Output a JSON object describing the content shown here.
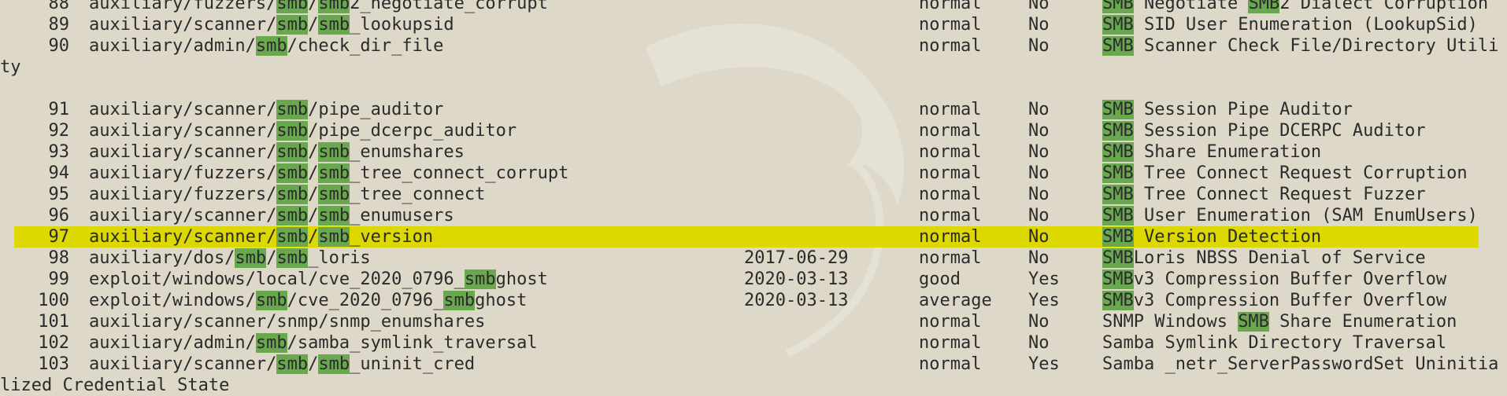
{
  "colors": {
    "background": "#ddd8c8",
    "text": "#2b2b2b",
    "match_highlight": "#6aa84f",
    "selected_row": "#dcd800"
  },
  "rows": [
    {
      "num": "88",
      "name": [
        [
          "auxiliary/fuzzers/",
          false
        ],
        [
          "smb",
          true
        ],
        [
          "/",
          false
        ],
        [
          "smb",
          true
        ],
        [
          "2_negotiate_corrupt",
          false
        ]
      ],
      "date": "",
      "rank": "normal",
      "check": "No",
      "desc": [
        [
          "SMB",
          true
        ],
        [
          " Negotiate ",
          false
        ],
        [
          "SMB",
          true
        ],
        [
          "2 Dialect Corruption",
          false
        ]
      ]
    },
    {
      "num": "89",
      "name": [
        [
          "auxiliary/scanner/",
          false
        ],
        [
          "smb",
          true
        ],
        [
          "/",
          false
        ],
        [
          "smb",
          true
        ],
        [
          "_lookupsid",
          false
        ]
      ],
      "date": "",
      "rank": "normal",
      "check": "No",
      "desc": [
        [
          "SMB",
          true
        ],
        [
          " SID User Enumeration (LookupSid)",
          false
        ]
      ]
    },
    {
      "num": "90",
      "name": [
        [
          "auxiliary/admin/",
          false
        ],
        [
          "smb",
          true
        ],
        [
          "/check_dir_file",
          false
        ]
      ],
      "date": "",
      "rank": "normal",
      "check": "No",
      "desc": [
        [
          "SMB",
          true
        ],
        [
          " Scanner Check File/Directory Utili",
          false
        ]
      ]
    },
    {
      "wrap": "ty"
    },
    {
      "blank": true
    },
    {
      "num": "91",
      "name": [
        [
          "auxiliary/scanner/",
          false
        ],
        [
          "smb",
          true
        ],
        [
          "/pipe_auditor",
          false
        ]
      ],
      "date": "",
      "rank": "normal",
      "check": "No",
      "desc": [
        [
          "SMB",
          true
        ],
        [
          " Session Pipe Auditor",
          false
        ]
      ]
    },
    {
      "num": "92",
      "name": [
        [
          "auxiliary/scanner/",
          false
        ],
        [
          "smb",
          true
        ],
        [
          "/pipe_dcerpc_auditor",
          false
        ]
      ],
      "date": "",
      "rank": "normal",
      "check": "No",
      "desc": [
        [
          "SMB",
          true
        ],
        [
          " Session Pipe DCERPC Auditor",
          false
        ]
      ]
    },
    {
      "num": "93",
      "name": [
        [
          "auxiliary/scanner/",
          false
        ],
        [
          "smb",
          true
        ],
        [
          "/",
          false
        ],
        [
          "smb",
          true
        ],
        [
          "_enumshares",
          false
        ]
      ],
      "date": "",
      "rank": "normal",
      "check": "No",
      "desc": [
        [
          "SMB",
          true
        ],
        [
          " Share Enumeration",
          false
        ]
      ]
    },
    {
      "num": "94",
      "name": [
        [
          "auxiliary/fuzzers/",
          false
        ],
        [
          "smb",
          true
        ],
        [
          "/",
          false
        ],
        [
          "smb",
          true
        ],
        [
          "_tree_connect_corrupt",
          false
        ]
      ],
      "date": "",
      "rank": "normal",
      "check": "No",
      "desc": [
        [
          "SMB",
          true
        ],
        [
          " Tree Connect Request Corruption",
          false
        ]
      ]
    },
    {
      "num": "95",
      "name": [
        [
          "auxiliary/fuzzers/",
          false
        ],
        [
          "smb",
          true
        ],
        [
          "/",
          false
        ],
        [
          "smb",
          true
        ],
        [
          "_tree_connect",
          false
        ]
      ],
      "date": "",
      "rank": "normal",
      "check": "No",
      "desc": [
        [
          "SMB",
          true
        ],
        [
          " Tree Connect Request Fuzzer",
          false
        ]
      ]
    },
    {
      "num": "96",
      "name": [
        [
          "auxiliary/scanner/",
          false
        ],
        [
          "smb",
          true
        ],
        [
          "/",
          false
        ],
        [
          "smb",
          true
        ],
        [
          "_enumusers",
          false
        ]
      ],
      "date": "",
      "rank": "normal",
      "check": "No",
      "desc": [
        [
          "SMB",
          true
        ],
        [
          " User Enumeration (SAM EnumUsers)",
          false
        ]
      ]
    },
    {
      "num": "97",
      "selected": true,
      "name": [
        [
          "auxiliary/scanner/",
          false
        ],
        [
          "smb",
          true
        ],
        [
          "/",
          false
        ],
        [
          "smb",
          true
        ],
        [
          "_version",
          false
        ]
      ],
      "date": "",
      "rank": "normal",
      "check": "No",
      "desc": [
        [
          "SMB",
          true
        ],
        [
          " Version Detection",
          false
        ]
      ]
    },
    {
      "num": "98",
      "name": [
        [
          "auxiliary/dos/",
          false
        ],
        [
          "smb",
          true
        ],
        [
          "/",
          false
        ],
        [
          "smb",
          true
        ],
        [
          "_loris",
          false
        ]
      ],
      "date": "2017-06-29",
      "rank": "normal",
      "check": "No",
      "desc": [
        [
          "SMB",
          true
        ],
        [
          "Loris NBSS Denial of Service",
          false
        ]
      ]
    },
    {
      "num": "99",
      "name": [
        [
          "exploit/windows/local/cve_2020_0796_",
          false
        ],
        [
          "smb",
          true
        ],
        [
          "ghost",
          false
        ]
      ],
      "date": "2020-03-13",
      "rank": "good",
      "check": "Yes",
      "desc": [
        [
          "SMB",
          true
        ],
        [
          "v3 Compression Buffer Overflow",
          false
        ]
      ]
    },
    {
      "num": "100",
      "name": [
        [
          "exploit/windows/",
          false
        ],
        [
          "smb",
          true
        ],
        [
          "/cve_2020_0796_",
          false
        ],
        [
          "smb",
          true
        ],
        [
          "ghost",
          false
        ]
      ],
      "date": "2020-03-13",
      "rank": "average",
      "check": "Yes",
      "desc": [
        [
          "SMB",
          true
        ],
        [
          "v3 Compression Buffer Overflow",
          false
        ]
      ]
    },
    {
      "num": "101",
      "name": [
        [
          "auxiliary/scanner/snmp/snmp_enumshares",
          false
        ]
      ],
      "date": "",
      "rank": "normal",
      "check": "No",
      "desc": [
        [
          "SNMP Windows ",
          false
        ],
        [
          "SMB",
          true
        ],
        [
          " Share Enumeration",
          false
        ]
      ]
    },
    {
      "num": "102",
      "name": [
        [
          "auxiliary/admin/",
          false
        ],
        [
          "smb",
          true
        ],
        [
          "/samba_symlink_traversal",
          false
        ]
      ],
      "date": "",
      "rank": "normal",
      "check": "No",
      "desc": [
        [
          "Samba Symlink Directory Traversal",
          false
        ]
      ]
    },
    {
      "num": "103",
      "name": [
        [
          "auxiliary/scanner/",
          false
        ],
        [
          "smb",
          true
        ],
        [
          "/",
          false
        ],
        [
          "smb",
          true
        ],
        [
          "_uninit_cred",
          false
        ]
      ],
      "date": "",
      "rank": "normal",
      "check": "Yes",
      "desc": [
        [
          "Samba _netr_ServerPasswordSet Uninitia",
          false
        ]
      ]
    },
    {
      "wrap": "lized Credential State"
    }
  ]
}
